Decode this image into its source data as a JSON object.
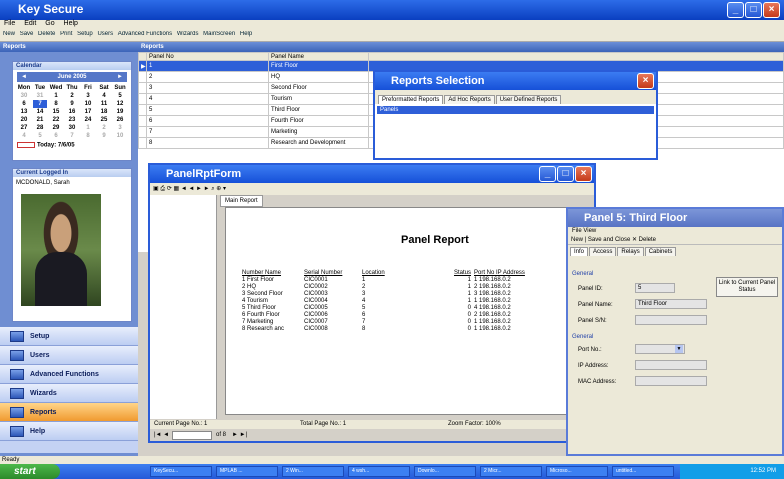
{
  "app": {
    "title": "Key Secure"
  },
  "menu": [
    "File",
    "Edit",
    "Go",
    "Help"
  ],
  "toolbar": [
    "New",
    "Save",
    "Delete",
    "Print",
    "Setup",
    "Users",
    "Advanced Functions",
    "Wizards",
    "MainScreen",
    "Help"
  ],
  "left": {
    "header": "Reports",
    "calendar_title": "Calendar",
    "month": "June 2005",
    "weekdays": [
      "Mon",
      "Tue",
      "Wed",
      "Thu",
      "Fri",
      "Sat",
      "Sun"
    ],
    "weeks": [
      [
        "30",
        "31",
        "1",
        "2",
        "3",
        "4",
        "5"
      ],
      [
        "6",
        "7",
        "8",
        "9",
        "10",
        "11",
        "12"
      ],
      [
        "13",
        "14",
        "15",
        "16",
        "17",
        "18",
        "19"
      ],
      [
        "20",
        "21",
        "22",
        "23",
        "24",
        "25",
        "26"
      ],
      [
        "27",
        "28",
        "29",
        "30",
        "1",
        "2",
        "3"
      ],
      [
        "4",
        "5",
        "6",
        "7",
        "8",
        "9",
        "10"
      ]
    ],
    "today": "Today: 7/6/05",
    "current_user_title": "Current Logged In",
    "current_user": "MCDONALD, Sarah",
    "nav": [
      "Setup",
      "Users",
      "Advanced Functions",
      "Wizards",
      "Reports",
      "Help"
    ],
    "active_nav": "Reports"
  },
  "grid": {
    "header": "Reports",
    "columns": [
      "Panel No",
      "Panel Name"
    ],
    "rows": [
      [
        "1",
        "First Floor"
      ],
      [
        "2",
        "HQ"
      ],
      [
        "3",
        "Second Floor"
      ],
      [
        "4",
        "Tourism"
      ],
      [
        "5",
        "Third Floor"
      ],
      [
        "6",
        "Fourth Floor"
      ],
      [
        "7",
        "Marketing"
      ],
      [
        "8",
        "Research and Development"
      ]
    ]
  },
  "reports_selection": {
    "title": "Reports Selection",
    "tabs": [
      "Preformatted Reports",
      "Ad Hoc Reports",
      "User Defined Reports"
    ],
    "selected_item": "Panels"
  },
  "panel_rpt": {
    "title": "PanelRptForm",
    "tab": "Main Report",
    "report_title": "Panel Report",
    "columns": [
      "Number Name",
      "Serial Number",
      "Location",
      "Status",
      "Port No IP Address"
    ],
    "rows": [
      [
        "1 First Floor",
        "CIC0001",
        "1",
        "1",
        "1 198.168.0.2"
      ],
      [
        "2 HQ",
        "CIC0002",
        "2",
        "1",
        "2 198.168.0.2"
      ],
      [
        "3 Second Floor",
        "CIC0003",
        "3",
        "1",
        "3 198.168.0.2"
      ],
      [
        "4 Tourism",
        "CIC0004",
        "4",
        "1",
        "1 198.168.0.2"
      ],
      [
        "5 Third Floor",
        "CIC0005",
        "5",
        "0",
        "4 198.168.0.2"
      ],
      [
        "6 Fourth Floor",
        "CIC0006",
        "6",
        "0",
        "2 198.168.0.2"
      ],
      [
        "7 Marketing",
        "CIC0007",
        "7",
        "0",
        "1 198.168.0.2"
      ],
      [
        "8 Research anc",
        "CIC0008",
        "8",
        "0",
        "1 198.168.0.2"
      ]
    ],
    "status": {
      "current_page": "Current Page No.: 1",
      "total_page": "Total Page No.: 1",
      "zoom": "Zoom Factor: 100%"
    },
    "page_of": "of 8"
  },
  "panel5": {
    "title": "Panel 5: Third Floor",
    "menu": [
      "File",
      "View"
    ],
    "toolbar": [
      "New",
      "Save and Close",
      "Delete"
    ],
    "tabs": [
      "Info",
      "Access",
      "Relays",
      "Cabinets"
    ],
    "general_label": "General",
    "panel_id_label": "Panel ID:",
    "panel_id": "5",
    "panel_name_label": "Panel Name:",
    "panel_name": "Third Floor",
    "panel_sn_label": "Panel S/N:",
    "general2_label": "General",
    "port_label": "Port No.:",
    "ip_label": "IP Address:",
    "mac_label": "MAC Address:",
    "link_btn": "Link to Current Panel Status"
  },
  "statusbar": "Ready",
  "taskbar": {
    "start": "start",
    "tasks": [
      "KeySecu...",
      "MPLAB ...",
      "2 Win...",
      "4 wsh...",
      "Downlo...",
      "2 Micr...",
      "Microso...",
      "untitled..."
    ],
    "clock": "12:52 PM"
  }
}
